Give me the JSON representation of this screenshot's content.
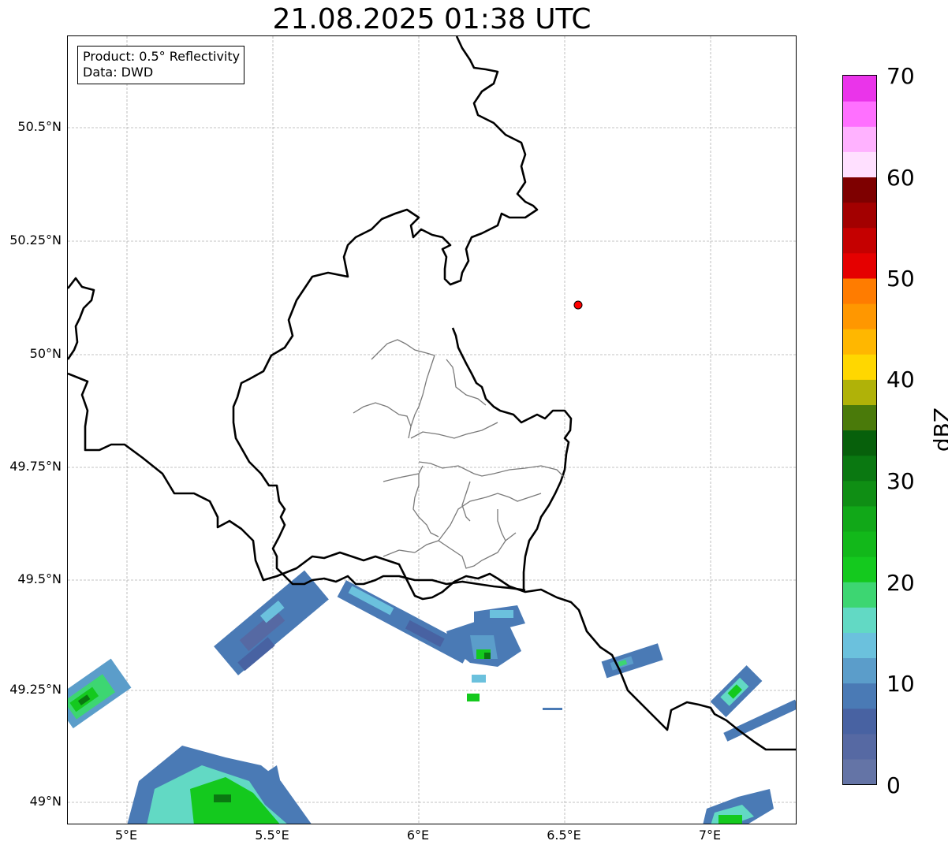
{
  "title": "21.08.2025 01:38 UTC",
  "infobox": {
    "product": "Product: 0.5° Reflectivity",
    "data": "Data: DWD"
  },
  "map": {
    "lat_labels": [
      "50.5°N",
      "50.25°N",
      "50°N",
      "49.75°N",
      "49.5°N",
      "49.25°N",
      "49°N"
    ],
    "lon_labels": [
      "5°E",
      "5.5°E",
      "6°E",
      "6.5°E",
      "7°E"
    ],
    "lat_range": [
      48.95,
      50.7
    ],
    "lon_range": [
      4.8,
      7.3
    ],
    "marker": {
      "lat": 50.11,
      "lon": 6.55,
      "color": "#ff0000"
    }
  },
  "colorbar": {
    "label": "dBZ",
    "ticks": [
      "0",
      "10",
      "20",
      "30",
      "40",
      "50",
      "60",
      "70"
    ],
    "colors": [
      "#6474a6",
      "#5669a3",
      "#4862a2",
      "#4a7ab5",
      "#5b9dca",
      "#6bc1dd",
      "#62d9c4",
      "#3dd672",
      "#14c91e",
      "#12b81a",
      "#11a818",
      "#0f8e14",
      "#0a7811",
      "#07600b",
      "#4a7a0a",
      "#b0b208",
      "#ffd700",
      "#ffb700",
      "#ff9700",
      "#ff7c00",
      "#e50000",
      "#c50000",
      "#a30000",
      "#7e0000",
      "#ffe0ff",
      "#ffb2ff",
      "#ff70ff",
      "#ea34ea"
    ]
  }
}
